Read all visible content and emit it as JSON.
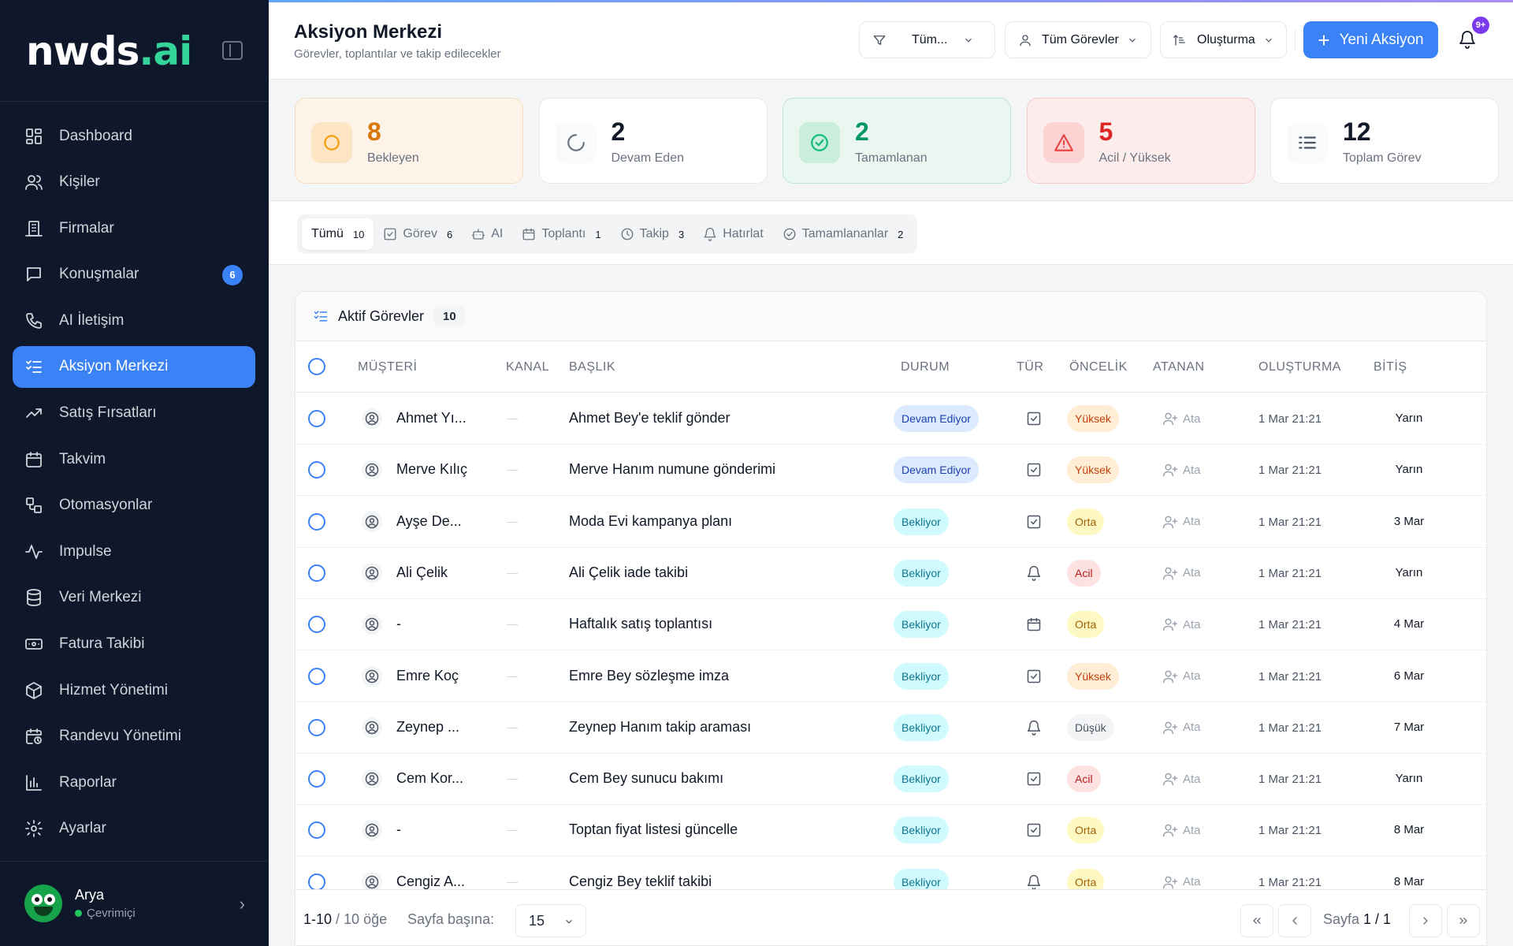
{
  "brand": {
    "main": "nwds",
    "suffix": ".ai"
  },
  "sidebar": {
    "items": [
      {
        "label": "Dashboard",
        "icon": "dashboard-icon"
      },
      {
        "label": "Kişiler",
        "icon": "users-icon"
      },
      {
        "label": "Firmalar",
        "icon": "building-icon"
      },
      {
        "label": "Konuşmalar",
        "icon": "message-icon",
        "badge": "6"
      },
      {
        "label": "AI İletişim",
        "icon": "phone-icon"
      },
      {
        "label": "Aksiyon Merkezi",
        "icon": "list-check-icon",
        "active": true
      },
      {
        "label": "Satış Fırsatları",
        "icon": "trending-up-icon"
      },
      {
        "label": "Takvim",
        "icon": "calendar-icon"
      },
      {
        "label": "Otomasyonlar",
        "icon": "workflow-icon"
      },
      {
        "label": "Impulse",
        "icon": "activity-icon"
      },
      {
        "label": "Veri Merkezi",
        "icon": "database-icon"
      },
      {
        "label": "Fatura Takibi",
        "icon": "banknote-icon"
      },
      {
        "label": "Hizmet Yönetimi",
        "icon": "package-icon"
      },
      {
        "label": "Randevu Yönetimi",
        "icon": "calendar-clock-icon"
      },
      {
        "label": "Raporlar",
        "icon": "bar-chart-icon"
      },
      {
        "label": "Ayarlar",
        "icon": "gear-icon"
      }
    ],
    "user": {
      "name": "Arya",
      "status": "Çevrimiçi"
    }
  },
  "header": {
    "title": "Aksiyon Merkezi",
    "subtitle": "Görevler, toplantılar ve takip edilecekler",
    "filters": {
      "status": "Tüm...",
      "assignee": "Tüm Görevler",
      "sort": "Oluşturma"
    },
    "new_button": "Yeni Aksiyon",
    "notification_badge": "9+"
  },
  "stats": [
    {
      "value": "8",
      "label": "Bekleyen",
      "bg": "#fdf3e8",
      "border": "#f5dcc0",
      "color": "#d97706",
      "icon_bg": "#fde4c4"
    },
    {
      "value": "2",
      "label": "Devam Eden",
      "bg": "#ffffff",
      "border": "#e5e7eb",
      "color": "#111827",
      "icon_bg": "#f9fafb"
    },
    {
      "value": "2",
      "label": "Tamamlanan",
      "bg": "#eaf7f1",
      "border": "#bfe7d3",
      "color": "#059669",
      "icon_bg": "#c9eedc"
    },
    {
      "value": "5",
      "label": "Acil / Yüksek",
      "bg": "#fdecec",
      "border": "#f6c9c9",
      "color": "#dc2626",
      "icon_bg": "#fbd3d3"
    },
    {
      "value": "12",
      "label": "Toplam Görev",
      "bg": "#ffffff",
      "border": "#e5e7eb",
      "color": "#111827",
      "icon_bg": "#f9fafb"
    }
  ],
  "tabs": [
    {
      "label": "Tümü",
      "count": "10",
      "active": true
    },
    {
      "label": "Görev",
      "count": "6",
      "icon": "checkbox-icon"
    },
    {
      "label": "AI",
      "count": "",
      "icon": "bot-icon"
    },
    {
      "label": "Toplantı",
      "count": "1",
      "icon": "calendar-icon"
    },
    {
      "label": "Takip",
      "count": "3",
      "icon": "clock-icon"
    },
    {
      "label": "Hatırlat",
      "count": "",
      "icon": "bell-icon"
    },
    {
      "label": "Tamamlananlar",
      "count": "2",
      "icon": "check-circle-icon"
    }
  ],
  "table": {
    "title": "Aktif Görevler",
    "count": "10",
    "columns": [
      "MÜŞTERİ",
      "KANAL",
      "BAŞLIK",
      "DURUM",
      "TÜR",
      "ÖNCELİK",
      "ATANAN",
      "OLUŞTURMA",
      "BİTİŞ"
    ],
    "rows": [
      {
        "customer": "Ahmet Yı...",
        "title": "Ahmet Bey'e teklif gönder",
        "status": "Devam Ediyor",
        "status_kind": "devam",
        "type": "task",
        "priority": "Yüksek",
        "prio_kind": "yuksek",
        "assignee": "Ata",
        "created": "1 Mar 21:21",
        "due": "Yarın"
      },
      {
        "customer": "Merve Kılıç",
        "title": "Merve Hanım numune gönderimi",
        "status": "Devam Ediyor",
        "status_kind": "devam",
        "type": "task",
        "priority": "Yüksek",
        "prio_kind": "yuksek",
        "assignee": "Ata",
        "created": "1 Mar 21:21",
        "due": "Yarın"
      },
      {
        "customer": "Ayşe De...",
        "title": "Moda Evi kampanya planı",
        "status": "Bekliyor",
        "status_kind": "bekliyor",
        "type": "task",
        "priority": "Orta",
        "prio_kind": "orta",
        "assignee": "Ata",
        "created": "1 Mar 21:21",
        "due": "3 Mar"
      },
      {
        "customer": "Ali Çelik",
        "title": "Ali Çelik iade takibi",
        "status": "Bekliyor",
        "status_kind": "bekliyor",
        "type": "reminder",
        "priority": "Acil",
        "prio_kind": "acil",
        "assignee": "Ata",
        "created": "1 Mar 21:21",
        "due": "Yarın"
      },
      {
        "customer": "-",
        "title": "Haftalık satış toplantısı",
        "status": "Bekliyor",
        "status_kind": "bekliyor",
        "type": "meeting",
        "priority": "Orta",
        "prio_kind": "orta",
        "assignee": "Ata",
        "created": "1 Mar 21:21",
        "due": "4 Mar"
      },
      {
        "customer": "Emre Koç",
        "title": "Emre Bey sözleşme imza",
        "status": "Bekliyor",
        "status_kind": "bekliyor",
        "type": "task",
        "priority": "Yüksek",
        "prio_kind": "yuksek",
        "assignee": "Ata",
        "created": "1 Mar 21:21",
        "due": "6 Mar"
      },
      {
        "customer": "Zeynep ...",
        "title": "Zeynep Hanım takip araması",
        "status": "Bekliyor",
        "status_kind": "bekliyor",
        "type": "reminder",
        "priority": "Düşük",
        "prio_kind": "dusuk",
        "assignee": "Ata",
        "created": "1 Mar 21:21",
        "due": "7 Mar"
      },
      {
        "customer": "Cem Kor...",
        "title": "Cem Bey sunucu bakımı",
        "status": "Bekliyor",
        "status_kind": "bekliyor",
        "type": "task",
        "priority": "Acil",
        "prio_kind": "acil",
        "assignee": "Ata",
        "created": "1 Mar 21:21",
        "due": "Yarın"
      },
      {
        "customer": "-",
        "title": "Toptan fiyat listesi güncelle",
        "status": "Bekliyor",
        "status_kind": "bekliyor",
        "type": "task",
        "priority": "Orta",
        "prio_kind": "orta",
        "assignee": "Ata",
        "created": "1 Mar 21:21",
        "due": "8 Mar"
      },
      {
        "customer": "Cengiz A...",
        "title": "Cengiz Bey teklif takibi",
        "status": "Bekliyor",
        "status_kind": "bekliyor",
        "type": "reminder",
        "priority": "Orta",
        "prio_kind": "orta",
        "assignee": "Ata",
        "created": "1 Mar 21:21",
        "due": "8 Mar"
      }
    ]
  },
  "pager": {
    "range": "1-10",
    "total": "10 öğe",
    "per_page_label": "Sayfa başına:",
    "per_page": "15",
    "page_label": "Sayfa",
    "page": "1 / 1"
  }
}
